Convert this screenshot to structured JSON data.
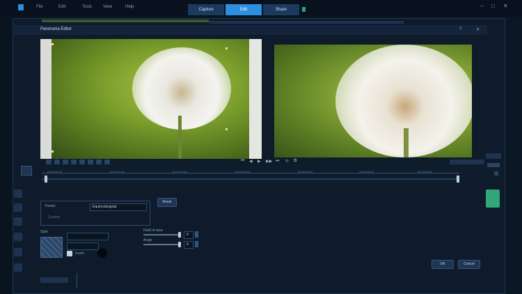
{
  "menu": {
    "items": [
      "File",
      "Edit",
      "Tools",
      "View",
      "Help"
    ]
  },
  "modes": [
    {
      "label": "Capture"
    },
    {
      "label": "Edit"
    },
    {
      "label": "Share"
    }
  ],
  "window": {
    "minimize": "–",
    "maximize": "□",
    "close": "✕"
  },
  "dialog": {
    "title": "Panorama Editor",
    "help": "?",
    "close": "✕"
  },
  "timeline": {
    "ticks": [
      "00:00:00:00",
      "00:00:01:00",
      "00:00:02:00",
      "00:00:03:00",
      "00:00:04:00",
      "00:00:05:00",
      "00:00:06:00",
      "00:00:07:00"
    ],
    "controls": [
      "⏮",
      "◀",
      "▶",
      "▶▶",
      "⏭",
      "↻",
      "⧉"
    ]
  },
  "settings": {
    "preset_label": "Preset",
    "preset_value": "Equirectangular",
    "preset_hint": "Custom",
    "reset": "Reset",
    "style_label": "Style",
    "slider1_label": "Field of view",
    "slider2_label": "Angle",
    "slider1_value": "0",
    "slider2_value": "0",
    "checkbox_label": "Invert",
    "ok": "OK",
    "cancel": "Cancel"
  },
  "colors": {
    "accent": "#2d8fe0",
    "background": "#0c1726",
    "panel": "#0f1b2b",
    "green_highlight": "#2fa777"
  }
}
